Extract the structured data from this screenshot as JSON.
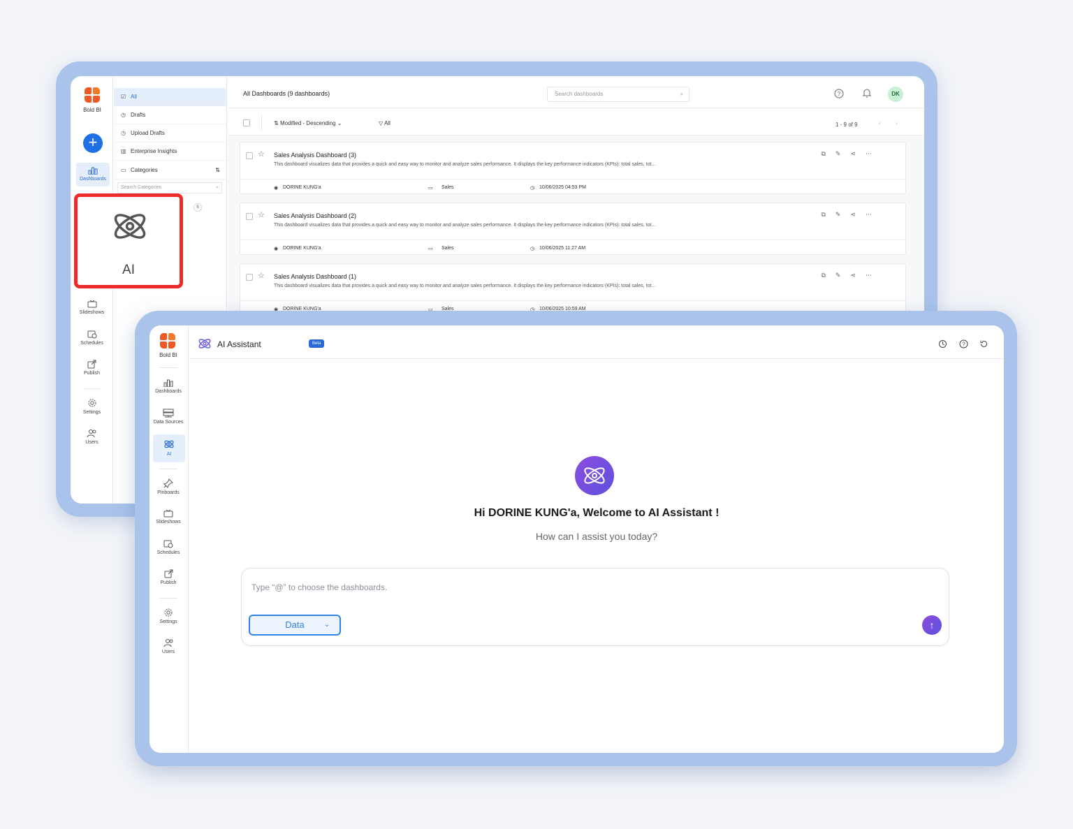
{
  "colors": {
    "accent": "#2a6ad8",
    "frame": "#a9c3ea",
    "highlight": "#ee2b2b",
    "ai_gradient": "#7b4fde"
  },
  "brand": {
    "name": "Bold BI"
  },
  "back": {
    "nav": {
      "dashboards": "Dashboards",
      "slideshows": "Slideshows",
      "schedules": "Schedules",
      "publish": "Publish",
      "settings": "Settings",
      "users": "Users"
    },
    "categories": {
      "all": "All",
      "drafts": "Drafts",
      "upload_drafts": "Upload Drafts",
      "enterprise_insights": "Enterprise Insights",
      "categories": "Categories",
      "search_placeholder": "Search Categories",
      "count": "5"
    },
    "header": {
      "title": "All Dashboards (9 dashboards)",
      "search_placeholder": "Search dashboards",
      "avatar": "DK"
    },
    "toolbar": {
      "sort": "Modified - Descending",
      "filter": "All",
      "pagination": "1 - 9 of 9"
    },
    "dashboards": [
      {
        "title": "Sales Analysis Dashboard (3)",
        "desc": "This dashboard visualizes data that provides a quick and easy way to monitor and analyze sales performance. It displays the key performance indicators (KPIs): total sales, tot...",
        "owner": "DORINE KUNG'a",
        "category": "Sales",
        "modified": "10/06/2025 04:53 PM"
      },
      {
        "title": "Sales Analysis Dashboard (2)",
        "desc": "This dashboard visualizes data that provides a quick and easy way to monitor and analyze sales performance. It displays the key performance indicators (KPIs): total sales, tot...",
        "owner": "DORINE KUNG'a",
        "category": "Sales",
        "modified": "10/06/2025 11:27 AM"
      },
      {
        "title": "Sales Analysis Dashboard (1)",
        "desc": "This dashboard visualizes data that provides a quick and easy way to monitor and analyze sales performance. It displays the key performance indicators (KPIs): total sales, tot...",
        "owner": "DORINE KUNG'a",
        "category": "Sales",
        "modified": "10/06/2025 10:59 AM"
      }
    ],
    "ai_highlight_label": "AI"
  },
  "front": {
    "nav": {
      "dashboards": "Dashboards",
      "data_sources": "Data Sources",
      "ai": "AI",
      "pinboards": "Pinboards",
      "slideshows": "Slideshows",
      "schedules": "Schedules",
      "publish": "Publish",
      "settings": "Settings",
      "users": "Users"
    },
    "header": {
      "title": "AI Assistant",
      "badge": "Beta"
    },
    "welcome": "Hi DORINE KUNG'a, Welcome to AI Assistant !",
    "subtitle": "How can I assist you today?",
    "prompt": {
      "placeholder": "Type “@” to choose the dashboards.",
      "mode": "Data"
    }
  }
}
